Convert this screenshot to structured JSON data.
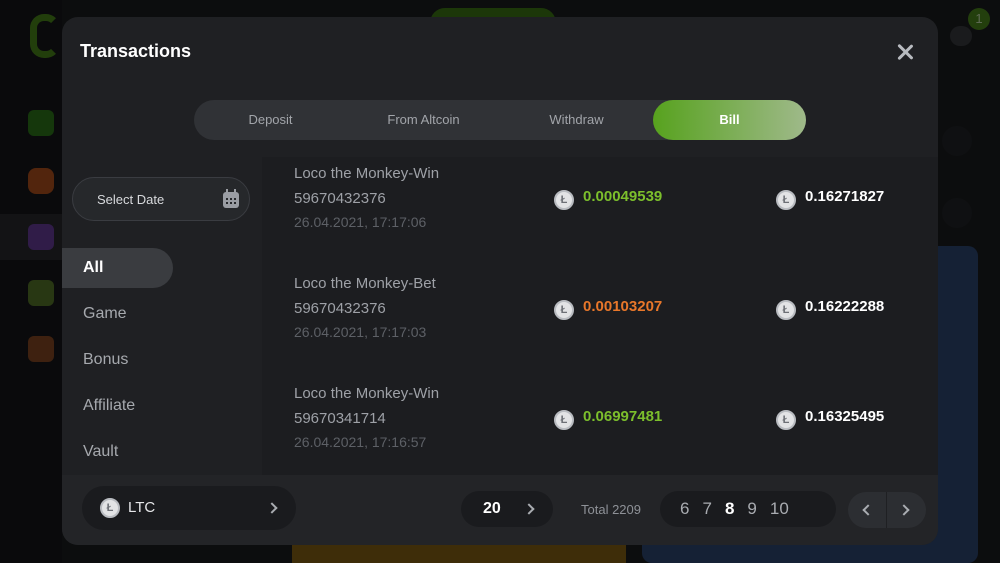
{
  "background": {
    "notification_count": "1"
  },
  "modal": {
    "title": "Transactions",
    "tabs": [
      {
        "label": "Deposit",
        "active": false
      },
      {
        "label": "From Altcoin",
        "active": false
      },
      {
        "label": "Withdraw",
        "active": false
      },
      {
        "label": "Bill",
        "active": true
      }
    ],
    "date_picker": {
      "label": "Select Date"
    },
    "filters": [
      {
        "label": "All",
        "active": true
      },
      {
        "label": "Game",
        "active": false
      },
      {
        "label": "Bonus",
        "active": false
      },
      {
        "label": "Affiliate",
        "active": false
      },
      {
        "label": "Vault",
        "active": false
      }
    ],
    "transactions": [
      {
        "name": "Loco the Monkey-Win",
        "id": "59670432376",
        "time": "26.04.2021, 17:17:06",
        "amount": "0.00049539",
        "amount_color": "#7cbf2c",
        "balance": "0.16271827"
      },
      {
        "name": "Loco the Monkey-Bet",
        "id": "59670432376",
        "time": "26.04.2021, 17:17:03",
        "amount": "0.00103207",
        "amount_color": "#e8772a",
        "balance": "0.16222288"
      },
      {
        "name": "Loco the Monkey-Win",
        "id": "59670341714",
        "time": "26.04.2021, 17:16:57",
        "amount": "0.06997481",
        "amount_color": "#7cbf2c",
        "balance": "0.16325495"
      }
    ],
    "footer": {
      "currency": "LTC",
      "per_page": "20",
      "total_label": "Total 2209",
      "pages": [
        "6",
        "7",
        "8",
        "9",
        "10"
      ],
      "current_page": "8"
    }
  }
}
